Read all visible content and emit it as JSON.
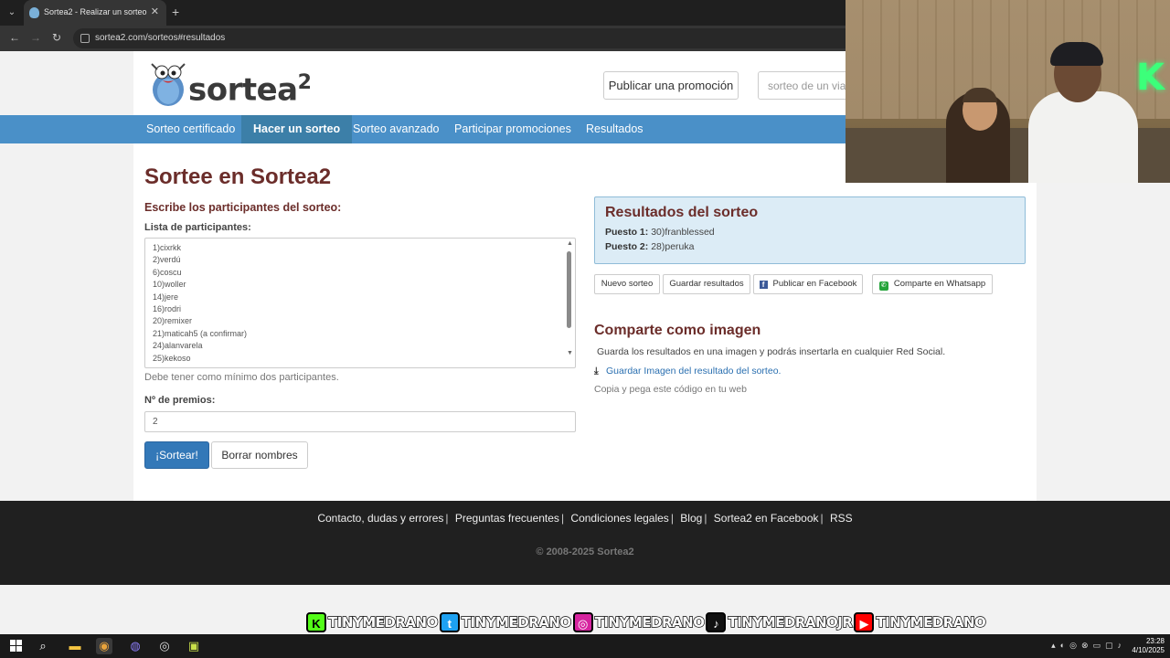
{
  "browser": {
    "tab_title": "Sortea2 - Realizar un sorteo",
    "tab_close": "✕",
    "new_tab": "+",
    "url": "sortea2.com/sorteos#resultados"
  },
  "header": {
    "logo_text": "sortea",
    "logo_suffix": "2",
    "publish_button": "Publicar una promoción",
    "search_placeholder": "sorteo de un via"
  },
  "nav": {
    "items": [
      {
        "label": "Sorteo certificado"
      },
      {
        "label": "Hacer un sorteo"
      },
      {
        "label": "Sorteo avanzado"
      },
      {
        "label": "Participar promociones"
      },
      {
        "label": "Resultados"
      }
    ]
  },
  "main": {
    "title": "Sortee en Sortea2",
    "section_label": "Escribe los participantes del sorteo:",
    "list_label": "Lista de participantes:",
    "participants": [
      "1)cixrkk",
      "2)verdú",
      "6)coscu",
      "10)woller",
      "14)jere",
      "16)rodri",
      "20)remixer",
      "21)maticah5 (a confirmar)",
      "24)alanvarela",
      "25)kekoso"
    ],
    "hint": "Debe tener como mínimo dos participantes.",
    "prizes_label": "Nº de premios:",
    "prizes_value": "2",
    "draw_button": "¡Sortear!",
    "clear_button": "Borrar nombres"
  },
  "results": {
    "title": "Resultados del sorteo",
    "lines": [
      {
        "label": "Puesto 1:",
        "value": "30)franblessed"
      },
      {
        "label": "Puesto 2:",
        "value": "28)peruka"
      }
    ],
    "buttons": {
      "new": "Nuevo sorteo",
      "save": "Guardar resultados",
      "facebook": "Publicar en Facebook",
      "whatsapp": "Comparte en Whatsapp"
    }
  },
  "share": {
    "title": "Comparte como imagen",
    "text": "Guarda los resultados en una imagen y podrás insertarla en cualquier Red Social.",
    "download_link": "Guardar Imagen del resultado del sorteo.",
    "copy_text": "Copia y pega este código en tu web"
  },
  "footer": {
    "links": [
      "Contacto, dudas y errores",
      "Preguntas frecuentes",
      "Condiciones legales",
      "Blog",
      "Sortea2 en Facebook",
      "RSS"
    ],
    "separator": "|",
    "copyright": "© 2008-2025 Sortea2"
  },
  "overlay": {
    "neon_letter": "K",
    "social": [
      {
        "platform": "kick",
        "badge": "K",
        "color": "#53fc18",
        "handle": "TINYMEDRANO"
      },
      {
        "platform": "twitter",
        "badge": "t",
        "color": "#1da1f2",
        "handle": "TINYMEDRANO"
      },
      {
        "platform": "instagram",
        "badge": "◎",
        "color": "#d6249f",
        "handle": "TINYMEDRANO"
      },
      {
        "platform": "tiktok",
        "badge": "♪",
        "color": "#111111",
        "handle": "TINYMEDRANOJR"
      },
      {
        "platform": "youtube",
        "badge": "▶",
        "color": "#ff0000",
        "handle": "TINYMEDRANO"
      }
    ]
  },
  "taskbar": {
    "time": "23:28",
    "date": "4/10/2025"
  },
  "colors": {
    "nav_blue": "#4a90c8",
    "nav_active": "#3c7fa8",
    "heading": "#6b2d2a",
    "primary_button": "#3378b8",
    "results_bg": "#dcecf6",
    "footer_bg": "#202020"
  }
}
